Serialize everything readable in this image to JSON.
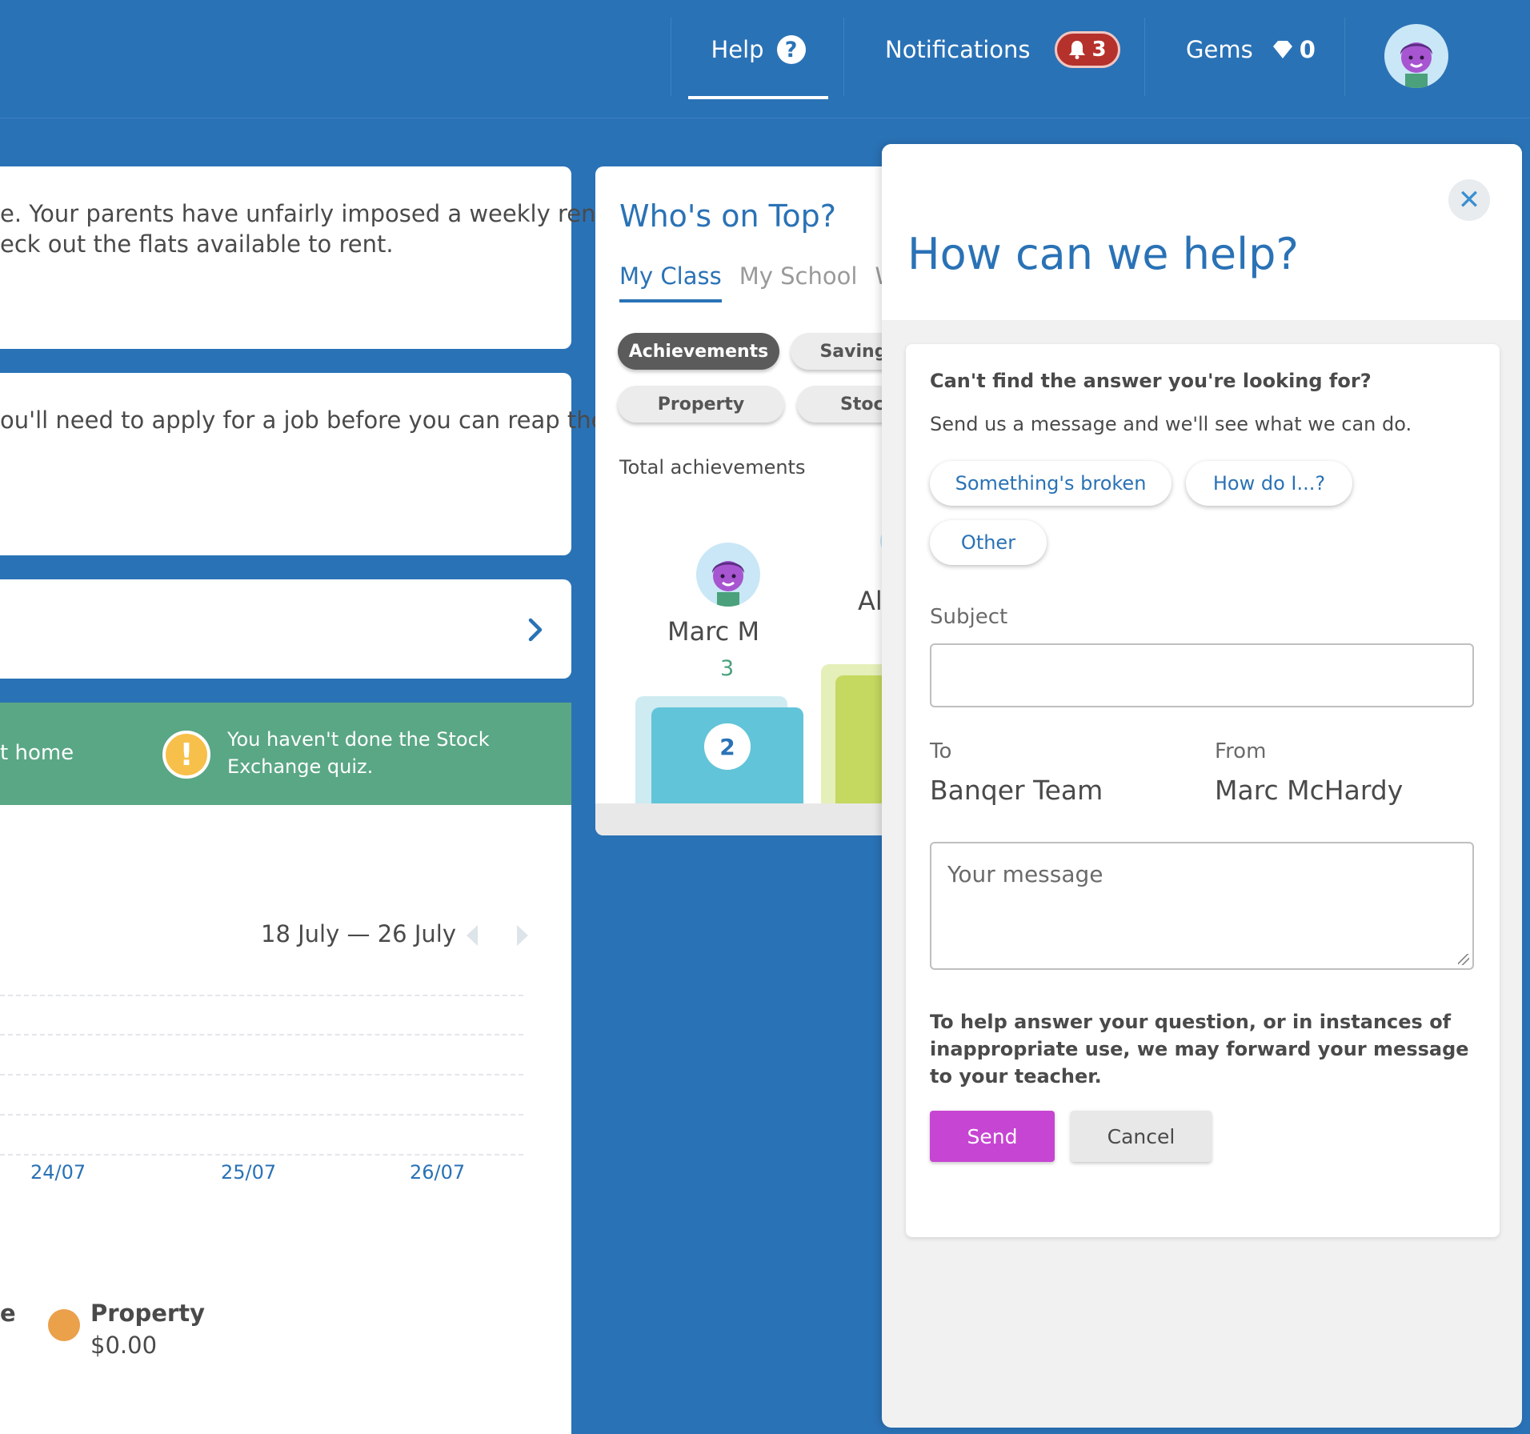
{
  "header": {
    "help_label": "Help",
    "help_glyph": "?",
    "notifications_label": "Notifications",
    "notifications_count": "3",
    "gems_label": "Gems",
    "gems_count": "0"
  },
  "left": {
    "card1_line1": "e. Your parents have unfairly imposed a weekly rent",
    "card1_line2": "eck out the flats available to rent.",
    "card2_line1": "ou'll need to apply for a job before you can reap the",
    "card3_arrow": "›",
    "green_left_text": "t home",
    "warning_glyph": "!",
    "green_message": "You haven't done the Stock Exchange quiz.",
    "date_range": "18 July — 26 July",
    "x_ticks": [
      "24/07",
      "25/07",
      "26/07"
    ],
    "legend_cut_label": "e",
    "legend_name": "Property",
    "legend_value": "$0.00"
  },
  "leaderboard": {
    "title": "Who's on Top?",
    "tabs": [
      "My Class",
      "My School",
      "Wo"
    ],
    "pills": [
      "Achievements",
      "Savings",
      "Property",
      "Stocl"
    ],
    "total_label": "Total achievements",
    "player_name": "Marc M",
    "player_score": "3",
    "player_rank": "2",
    "cut_name": "Al"
  },
  "help_panel": {
    "title": "How can we help?",
    "close_glyph": "✕",
    "question": "Can't find the answer you're looking for?",
    "subtitle": "Send us a message and we'll see what we can do.",
    "categories": [
      "Something's broken",
      "How do I...?",
      "Other"
    ],
    "subject_label": "Subject",
    "subject_value": "",
    "to_label": "To",
    "to_value": "Banqer Team",
    "from_label": "From",
    "from_value": "Marc McHardy",
    "message_placeholder": "Your message",
    "disclaimer": "To help answer your question, or in instances of inappropriate use, we may forward your message to your teacher.",
    "send_label": "Send",
    "cancel_label": "Cancel"
  },
  "colors": {
    "brand_blue": "#2a72b6",
    "send_purple": "#c745d3",
    "banner_green": "#5aa785",
    "warning_yellow": "#f7c04a",
    "notif_red": "#b5312c",
    "property_orange": "#eba04a"
  },
  "icons": [
    "help-icon",
    "bell-icon",
    "gem-icon",
    "avatar-icon",
    "chevron-right-icon",
    "warning-icon",
    "close-icon",
    "prev-arrow-icon",
    "next-arrow-icon"
  ]
}
